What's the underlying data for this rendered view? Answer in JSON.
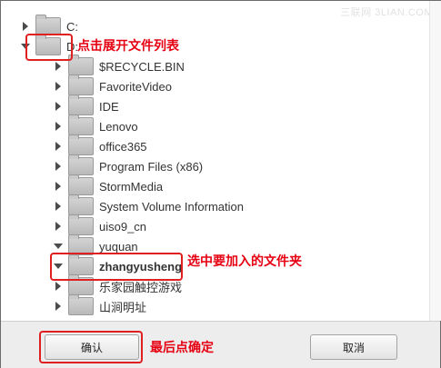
{
  "watermark": "三联网 3LIAN.COM",
  "tree": {
    "drives": [
      {
        "label": "C:",
        "expanded": false
      },
      {
        "label": "D:",
        "expanded": true
      }
    ],
    "children": [
      {
        "label": "$RECYCLE.BIN",
        "expanded": false
      },
      {
        "label": "FavoriteVideo",
        "expanded": false
      },
      {
        "label": "IDE",
        "expanded": false
      },
      {
        "label": "Lenovo",
        "expanded": false
      },
      {
        "label": "office365",
        "expanded": false
      },
      {
        "label": "Program Files (x86)",
        "expanded": false
      },
      {
        "label": "StormMedia",
        "expanded": false
      },
      {
        "label": "System Volume Information",
        "expanded": false
      },
      {
        "label": "uiso9_cn",
        "expanded": false
      },
      {
        "label": "yuquan",
        "expanded": true
      },
      {
        "label": "zhangyusheng",
        "expanded": true,
        "selected": true
      },
      {
        "label": "乐家园触控游戏",
        "expanded": false
      },
      {
        "label": "山涧明址",
        "expanded": false
      }
    ]
  },
  "annotations": {
    "expand": "点击展开文件列表",
    "select": "选中要加入的文件夹",
    "confirm": "最后点确定"
  },
  "buttons": {
    "ok": "确认",
    "cancel": "取消"
  },
  "colors": {
    "annotation": "#e60012",
    "highlight_box": "#e02020"
  }
}
